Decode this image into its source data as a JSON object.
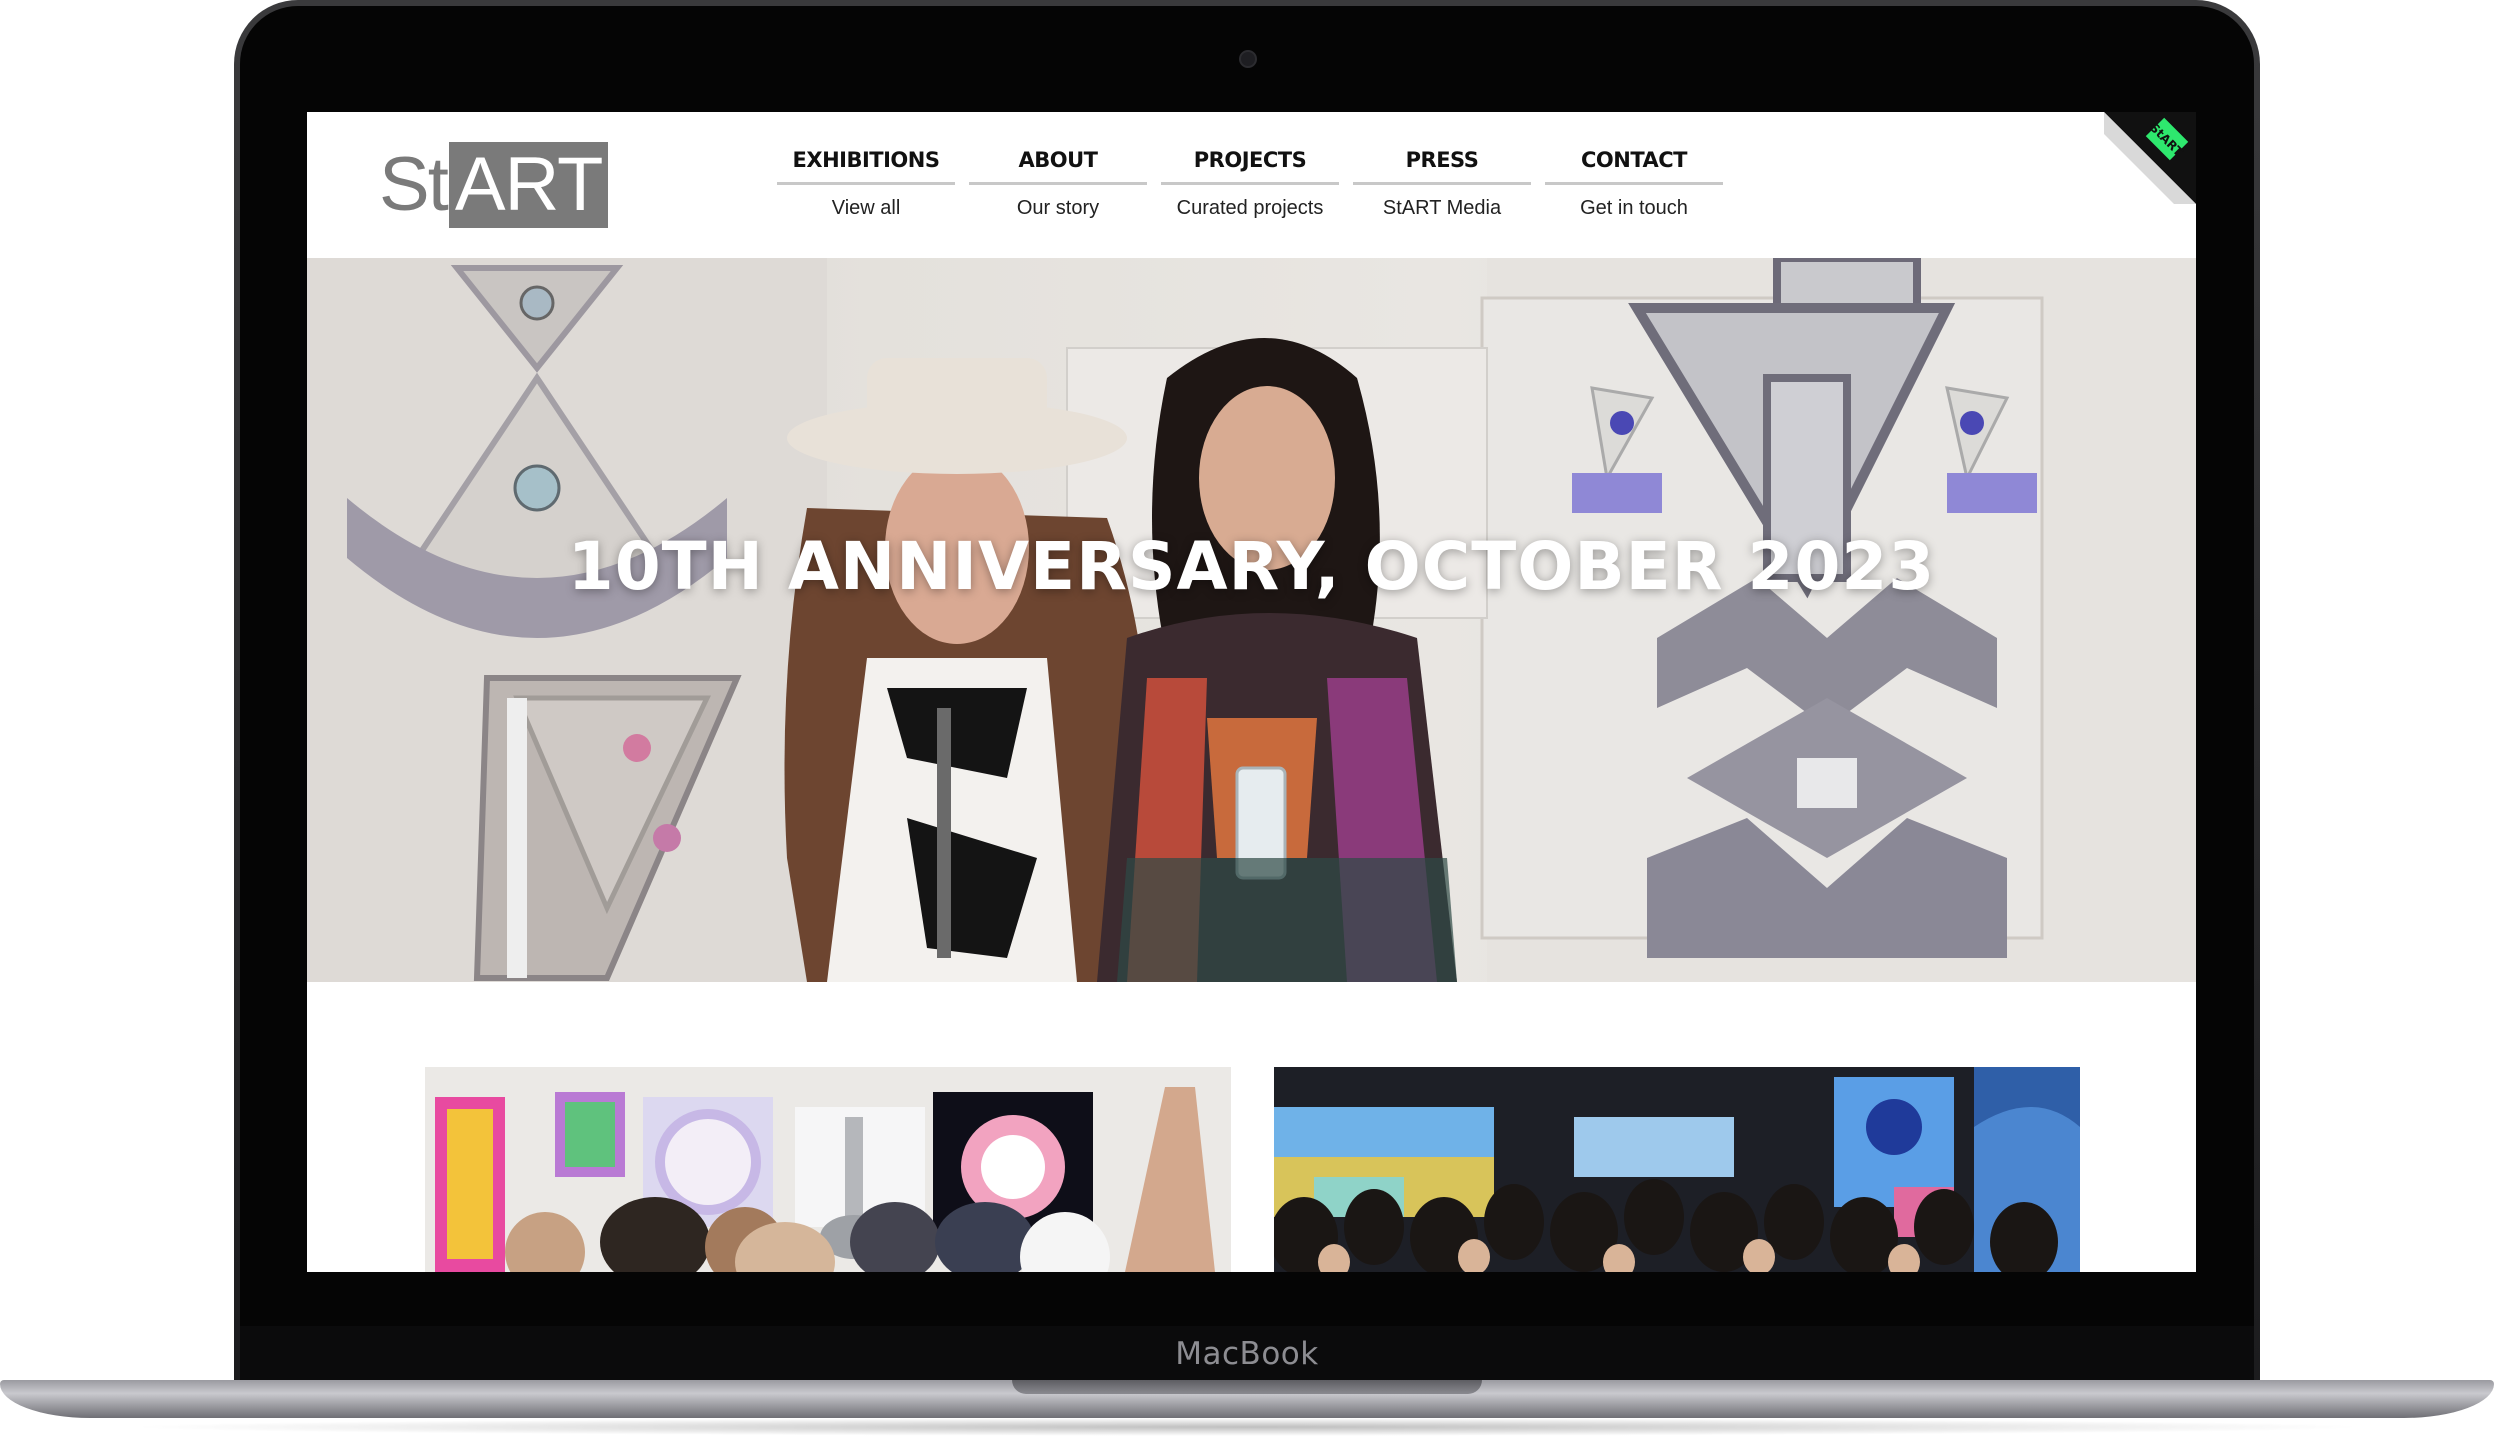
{
  "device": {
    "brand": "MacBook"
  },
  "site": {
    "logo": {
      "part1": "St",
      "part2": "ART"
    },
    "corner_badge": "StART",
    "nav": [
      {
        "title": "EXHIBITIONS",
        "subtitle": "View all"
      },
      {
        "title": "ABOUT",
        "subtitle": "Our story"
      },
      {
        "title": "PROJECTS",
        "subtitle": "Curated projects"
      },
      {
        "title": "PRESS",
        "subtitle": "StART Media"
      },
      {
        "title": "CONTACT",
        "subtitle": "Get in touch"
      }
    ],
    "hero": {
      "title": "10TH ANNIVERSARY, OCTOBER 2023"
    }
  }
}
